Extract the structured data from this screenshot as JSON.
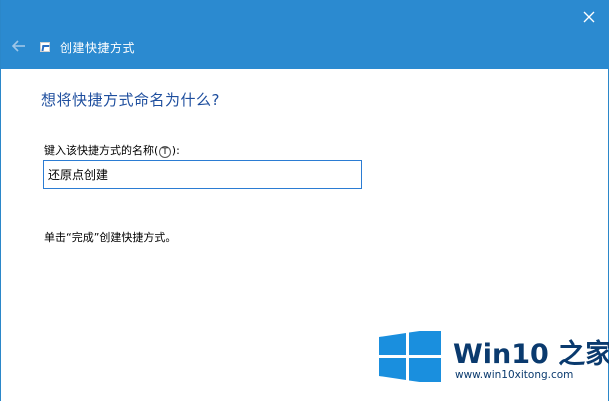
{
  "window": {
    "title": "创建快捷方式",
    "close_icon": "close-icon",
    "back_icon": "back-arrow-icon",
    "accent_color": "#2b8ad0"
  },
  "wizard": {
    "heading": "想将快捷方式命名为什么?",
    "field_label_prefix": "键入该快捷方式的名称(",
    "field_label_key": "T",
    "field_label_suffix": "):",
    "name_value": "还原点创建",
    "hint": "单击“完成”创建快捷方式。"
  },
  "watermark": {
    "brand": "Win10 之家",
    "url": "www.win10xitong.com",
    "logo_color": "#1a8fde"
  }
}
